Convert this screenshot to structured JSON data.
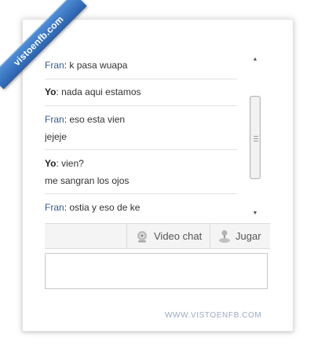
{
  "ribbon": {
    "text": "vistoenfb.com"
  },
  "messages": [
    {
      "sender": "Fran",
      "lines": [
        "k pasa wuapa"
      ]
    },
    {
      "sender": "Yo",
      "lines": [
        "nada aqui estamos"
      ]
    },
    {
      "sender": "Fran",
      "lines": [
        "eso esta vien",
        "jejeje"
      ]
    },
    {
      "sender": "Yo",
      "lines": [
        "vien?",
        "me sangran los ojos"
      ]
    },
    {
      "sender": "Fran",
      "lines": [
        "ostia y eso de ke"
      ]
    }
  ],
  "toolbar": {
    "video_label": "Video chat",
    "game_label": "Jugar"
  },
  "composer": {
    "value": ""
  },
  "footer": {
    "watermark": "WWW.VISTOENFB.COM"
  },
  "colors": {
    "friend_name": "#3b5b8c",
    "ribbon": "#3a78c7"
  },
  "icons": {
    "video": "webcam-icon",
    "game": "joystick-icon"
  }
}
